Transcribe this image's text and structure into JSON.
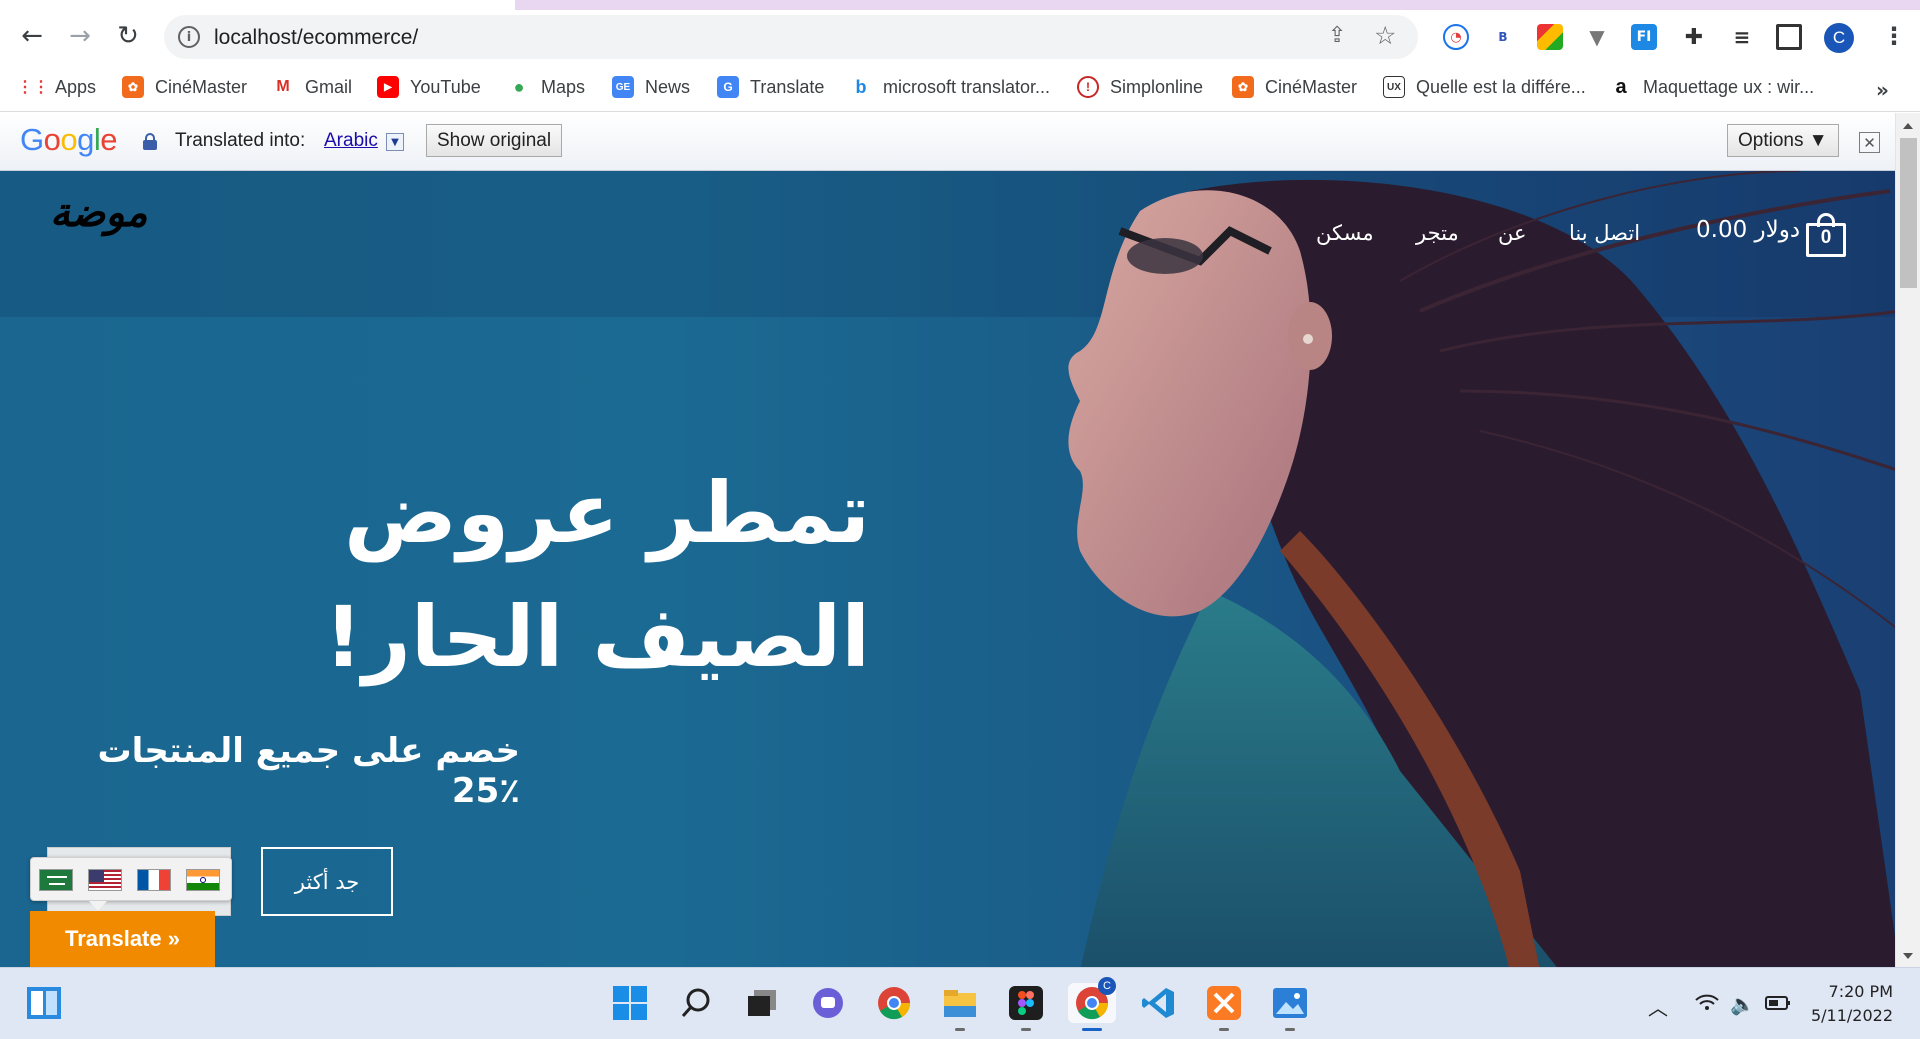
{
  "browser": {
    "url": "localhost/ecommerce/",
    "profile_initial": "C",
    "bookmarks": [
      {
        "label": "Apps",
        "icon": "apps-grid-icon"
      },
      {
        "label": "CinéMaster",
        "icon": "cinemaster-icon"
      },
      {
        "label": "Gmail",
        "icon": "gmail-icon"
      },
      {
        "label": "YouTube",
        "icon": "youtube-icon"
      },
      {
        "label": "Maps",
        "icon": "maps-icon"
      },
      {
        "label": "News",
        "icon": "news-icon"
      },
      {
        "label": "Translate",
        "icon": "translate-icon"
      },
      {
        "label": "microsoft translator...",
        "icon": "bing-icon"
      },
      {
        "label": "Simplonline",
        "icon": "simplonline-icon"
      },
      {
        "label": "CinéMaster",
        "icon": "cinemaster-icon"
      },
      {
        "label": "Quelle est la différe...",
        "icon": "ux-blog-icon"
      },
      {
        "label": "Maquettage ux : wir...",
        "icon": "amazon-icon"
      }
    ],
    "more_bookmarks": "»"
  },
  "translate_bar": {
    "logo": [
      "G",
      "o",
      "o",
      "g",
      "l",
      "e"
    ],
    "label": "Translated into:",
    "language": "Arabic",
    "show_original": "Show original",
    "options": "Options ▼",
    "close": "✕"
  },
  "site": {
    "logo": "موضة",
    "nav": [
      "مسكن",
      "متجر",
      "عن",
      "اتصل بنا"
    ],
    "cart_total": "0.00 دولار",
    "cart_count": "0",
    "headline": "تمطر عروض الصيف الحار!",
    "subline": "خصم على جميع المنتجات ٪25",
    "cta": "جد أكثر",
    "translate_button": "Translate »",
    "flags": [
      "saudi-arabia-flag",
      "usa-flag",
      "france-flag",
      "india-flag"
    ]
  },
  "taskbar": {
    "apps": [
      "widgets-icon",
      "windows-start-icon",
      "search-icon",
      "task-view-icon",
      "teams-chat-icon",
      "chrome-icon",
      "file-explorer-icon",
      "figma-icon",
      "chrome-profile-icon",
      "vscode-icon",
      "xampp-icon",
      "photos-icon"
    ],
    "time": "7:20 PM",
    "date": "5/11/2022"
  },
  "colors": {
    "hero_blue": "#1a6690",
    "translate_orange": "#f28a00",
    "link_blue": "#1a0dab"
  }
}
